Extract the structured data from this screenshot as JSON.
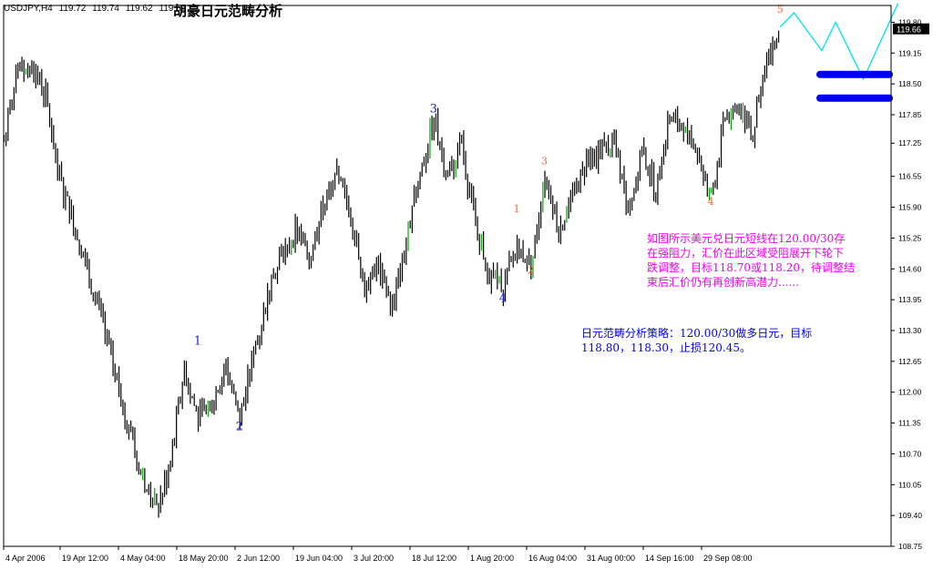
{
  "header": {
    "symbol": "USDJPY,H4",
    "open": "119.72",
    "high": "119.74",
    "low": "119.62",
    "close": "119.66",
    "title": "胡豪日元范畴分析"
  },
  "price_badge": "119.66",
  "annotations": {
    "analysis_lines": [
      "如图所示美元兑日元短线在120.00/30存",
      "在强阻力，汇价在此区域受阻展开下轮下",
      "跌调整，目标118.70或118.20，待调整结",
      "束后汇价仍有再创新高潜力......"
    ],
    "strategy_lines": [
      "日元范畴分析策略：120.00/30做多日元，目标",
      "118.80，118.30，止损120.45。"
    ]
  },
  "colors": {
    "background": "#ffffff",
    "candles": "#000000",
    "up_wick_accent": "#00aa00",
    "wave_blue": "#2020cc",
    "wave_orange": "#ee6633",
    "projection": "#00e5ee",
    "target_bars": "#0000ee",
    "analysis_text": "#ee00ee",
    "strategy_text": "#0000ee",
    "badge_bg": "#000000",
    "badge_text": "#ffffff"
  },
  "chart_data": {
    "type": "line",
    "title": "胡豪日元范畴分析",
    "symbol": "USDJPY",
    "timeframe": "H4",
    "ylim": [
      108.75,
      120.0
    ],
    "y_ticks": [
      "119.80",
      "119.15",
      "118.50",
      "117.85",
      "117.25",
      "116.55",
      "115.90",
      "115.25",
      "114.60",
      "113.95",
      "113.30",
      "112.65",
      "112.00",
      "111.35",
      "110.70",
      "110.05",
      "109.40",
      "108.75"
    ],
    "x_ticks": [
      "4 Apr 2006",
      "19 Apr 12:00",
      "4 May 04:00",
      "18 May 20:00",
      "2 Jun 12:00",
      "19 Jun 04:00",
      "3 Jul 20:00",
      "18 Jul 12:00",
      "1 Aug 20:00",
      "16 Aug 04:00",
      "31 Aug 00:00",
      "14 Sep 16:00",
      "29 Sep 08:00"
    ],
    "grid": false,
    "series": [
      {
        "kind": "price",
        "x": [
          "4 Apr 2006",
          "19 Apr 12:00",
          "4 May 04:00",
          "18 May 20:00",
          "2 Jun 12:00",
          "19 Jun 04:00",
          "3 Jul 20:00",
          "18 Jul 12:00",
          "1 Aug 20:00",
          "16 Aug 04:00",
          "31 Aug 00:00",
          "14 Sep 16:00",
          "29 Sep 08:00"
        ],
        "anchors": [
          {
            "i": 0,
            "y": 117.3
          },
          {
            "i": 1,
            "y": 118.7
          },
          {
            "i": 2,
            "y": 118.9
          },
          {
            "i": 3,
            "y": 118.2
          },
          {
            "i": 4,
            "y": 116.5
          },
          {
            "i": 5,
            "y": 115.6
          },
          {
            "i": 6,
            "y": 114.6
          },
          {
            "i": 7,
            "y": 113.5
          },
          {
            "i": 8,
            "y": 112.4
          },
          {
            "i": 9,
            "y": 111.2
          },
          {
            "i": 10,
            "y": 110.2
          },
          {
            "i": 11,
            "y": 109.5
          },
          {
            "i": 12,
            "y": 110.5
          },
          {
            "i": 13,
            "y": 112.5
          },
          {
            "i": 14,
            "y": 111.4
          },
          {
            "i": 15,
            "y": 111.8
          },
          {
            "i": 16,
            "y": 112.5
          },
          {
            "i": 17,
            "y": 111.4
          },
          {
            "i": 18,
            "y": 112.8
          },
          {
            "i": 19,
            "y": 114.0
          },
          {
            "i": 20,
            "y": 114.9
          },
          {
            "i": 21,
            "y": 115.4
          },
          {
            "i": 22,
            "y": 114.8
          },
          {
            "i": 23,
            "y": 115.9
          },
          {
            "i": 24,
            "y": 116.5
          },
          {
            "i": 25,
            "y": 115.8
          },
          {
            "i": 26,
            "y": 114.2
          },
          {
            "i": 27,
            "y": 114.6
          },
          {
            "i": 28,
            "y": 113.8
          },
          {
            "i": 29,
            "y": 115.2
          },
          {
            "i": 30,
            "y": 116.6
          },
          {
            "i": 31,
            "y": 117.8
          },
          {
            "i": 32,
            "y": 116.5
          },
          {
            "i": 33,
            "y": 117.2
          },
          {
            "i": 34,
            "y": 115.5
          },
          {
            "i": 35,
            "y": 114.5
          },
          {
            "i": 36,
            "y": 114.2
          },
          {
            "i": 37,
            "y": 115.1
          },
          {
            "i": 38,
            "y": 114.6
          },
          {
            "i": 39,
            "y": 116.6
          },
          {
            "i": 40,
            "y": 115.4
          },
          {
            "i": 41,
            "y": 116.1
          },
          {
            "i": 42,
            "y": 116.8
          },
          {
            "i": 43,
            "y": 117.1
          },
          {
            "i": 44,
            "y": 117.3
          },
          {
            "i": 45,
            "y": 115.8
          },
          {
            "i": 46,
            "y": 117.1
          },
          {
            "i": 47,
            "y": 116.3
          },
          {
            "i": 48,
            "y": 117.8
          },
          {
            "i": 49,
            "y": 117.5
          },
          {
            "i": 50,
            "y": 117.1
          },
          {
            "i": 51,
            "y": 116.1
          },
          {
            "i": 52,
            "y": 117.8
          },
          {
            "i": 53,
            "y": 118.0
          },
          {
            "i": 54,
            "y": 117.5
          },
          {
            "i": 55,
            "y": 118.9
          },
          {
            "i": 56,
            "y": 119.7
          }
        ]
      },
      {
        "kind": "projection",
        "points": [
          {
            "i": 56,
            "y": 119.7
          },
          {
            "i": 57,
            "y": 120.0
          },
          {
            "i": 59,
            "y": 119.2
          },
          {
            "i": 60,
            "y": 119.8
          },
          {
            "i": 62,
            "y": 118.6
          },
          {
            "i": 64.5,
            "y": 120.2
          }
        ]
      }
    ],
    "levels": [
      118.7,
      118.2
    ],
    "wave_labels": [
      {
        "label": "1",
        "i": 14,
        "y": 113.0,
        "color": "blue"
      },
      {
        "label": "2",
        "i": 17,
        "y": 111.2,
        "color": "blue"
      },
      {
        "label": "3",
        "i": 31,
        "y": 117.9,
        "color": "blue"
      },
      {
        "label": "4",
        "i": 36,
        "y": 113.9,
        "color": "blue"
      },
      {
        "label": "1",
        "i": 37,
        "y": 115.8,
        "color": "orange"
      },
      {
        "label": "2",
        "i": 38,
        "y": 114.5,
        "color": "orange"
      },
      {
        "label": "3",
        "i": 39,
        "y": 116.8,
        "color": "orange"
      },
      {
        "label": "4",
        "i": 51,
        "y": 115.95,
        "color": "orange"
      },
      {
        "label": "5",
        "i": 56,
        "y": 120.0,
        "color": "orange"
      }
    ],
    "last_price": 119.66
  }
}
